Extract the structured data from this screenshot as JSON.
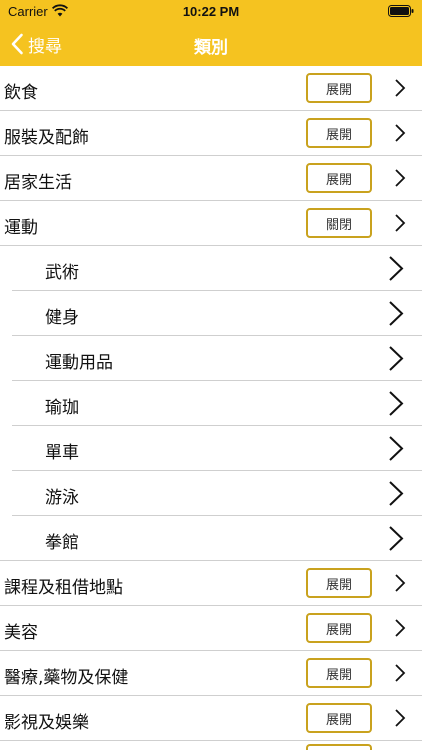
{
  "status": {
    "carrier": "Carrier",
    "time": "10:22 PM"
  },
  "nav": {
    "back_label": "搜尋",
    "title": "類別"
  },
  "colors": {
    "accent": "#F5C320",
    "button_border": "#C9A21E",
    "divider": "#cfcfcf"
  },
  "categories": [
    {
      "label": "飲食",
      "button": "展開",
      "expanded": false
    },
    {
      "label": "服裝及配飾",
      "button": "展開",
      "expanded": false
    },
    {
      "label": "居家生活",
      "button": "展開",
      "expanded": false
    },
    {
      "label": "運動",
      "button": "關閉",
      "expanded": true,
      "children": [
        "武術",
        "健身",
        "運動用品",
        "瑜珈",
        "單車",
        "游泳",
        "拳館"
      ]
    },
    {
      "label": "課程及租借地點",
      "button": "展開",
      "expanded": false
    },
    {
      "label": "美容",
      "button": "展開",
      "expanded": false
    },
    {
      "label": "醫療,藥物及保健",
      "button": "展開",
      "expanded": false
    },
    {
      "label": "影視及娛樂",
      "button": "展開",
      "expanded": false
    }
  ]
}
